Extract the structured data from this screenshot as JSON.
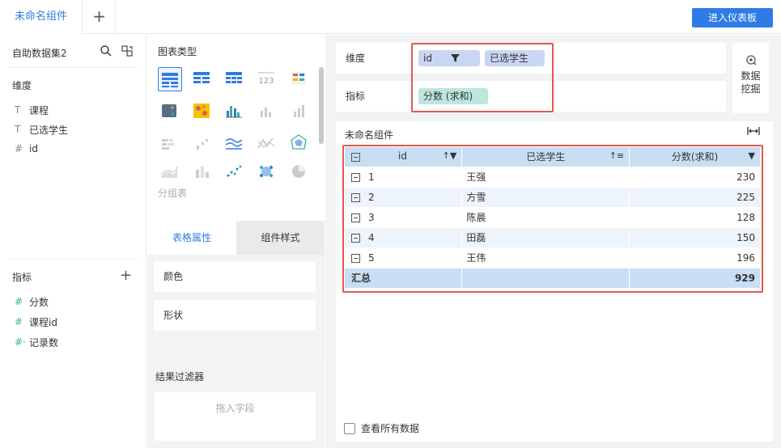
{
  "topbar": {
    "tab_label": "未命名组件",
    "add_tab": "+",
    "enter_button": "进入仪表板"
  },
  "left": {
    "dataset_title": "自助数据集2",
    "dimensions_title": "维度",
    "dimensions": [
      {
        "icon": "T",
        "label": "课程"
      },
      {
        "icon": "T",
        "label": "已选学生"
      },
      {
        "icon": "#",
        "label": "id"
      }
    ],
    "measures_title": "指标",
    "measures": [
      {
        "icon": "#",
        "label": "分数"
      },
      {
        "icon": "#",
        "label": "课程id"
      },
      {
        "icon": "#·",
        "label": "记录数"
      }
    ]
  },
  "middle": {
    "chart_type_title": "图表类型",
    "chart_type_label": "分组表",
    "tab_active": "表格属性",
    "tab_inactive": "组件样式",
    "color_label": "颜色",
    "shape_label": "形状",
    "filter_title": "结果过滤器",
    "filter_placeholder": "拖入字段"
  },
  "right": {
    "dim_label": "维度",
    "dim_pills": [
      "id",
      "已选学生"
    ],
    "mea_label": "指标",
    "mea_pill": "分数 (求和)",
    "mining_line1": "数据",
    "mining_line2": "挖掘",
    "component_title": "未命名组件",
    "see_all": "查看所有数据"
  },
  "table": {
    "headers": [
      "id",
      "已选学生",
      "分数(求和)"
    ],
    "rows": [
      {
        "id": "1",
        "name": "王强",
        "score": "230"
      },
      {
        "id": "2",
        "name": "方雪",
        "score": "225"
      },
      {
        "id": "3",
        "name": "陈晨",
        "score": "128"
      },
      {
        "id": "4",
        "name": "田磊",
        "score": "150"
      },
      {
        "id": "5",
        "name": "王伟",
        "score": "196"
      }
    ],
    "total_label": "汇总",
    "total_value": "929"
  },
  "colors": {
    "accent": "#2f7be5",
    "highlight": "#e05a4e",
    "header_bg": "#c8def4"
  }
}
